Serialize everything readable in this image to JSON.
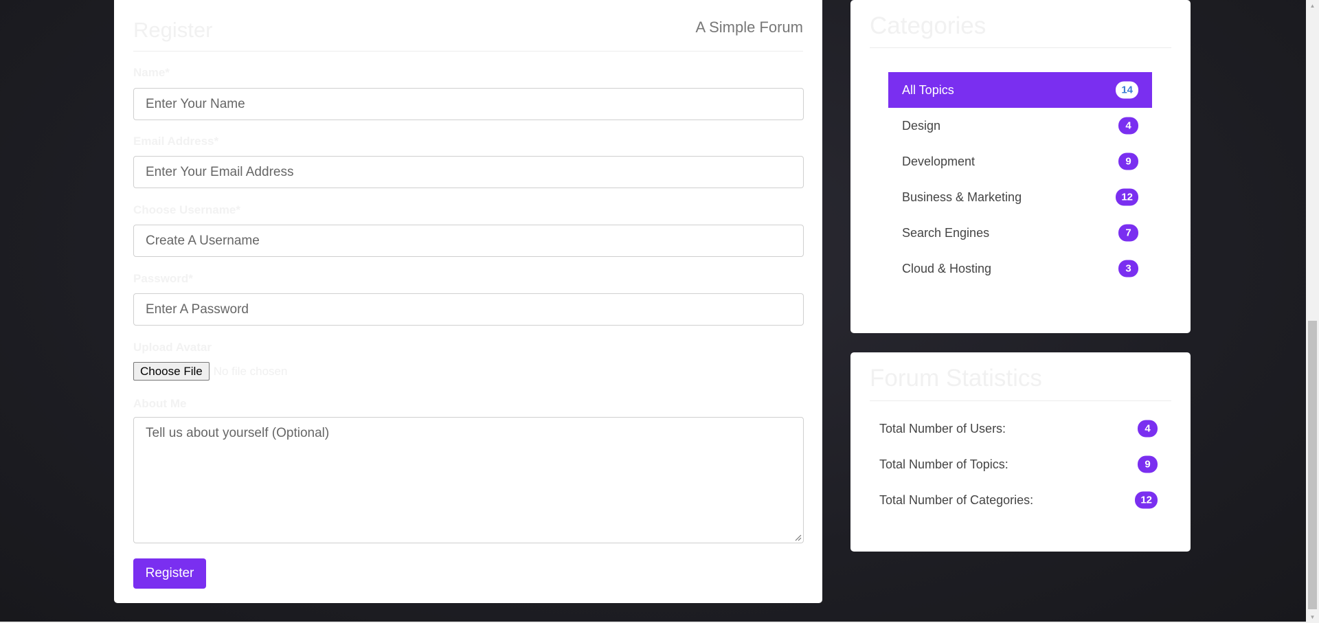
{
  "register": {
    "title": "Register",
    "forum_name": "A Simple Forum",
    "fields": {
      "name_label": "Name*",
      "name_placeholder": "Enter Your Name",
      "email_label": "Email Address*",
      "email_placeholder": "Enter Your Email Address",
      "username_label": "Choose Username*",
      "username_placeholder": "Create A Username",
      "password_label": "Password*",
      "password_placeholder": "Enter A Password",
      "avatar_label": "Upload Avatar",
      "file_button": "Choose File",
      "file_status": "No file chosen",
      "about_label": "About Me",
      "about_placeholder": "Tell us about yourself (Optional)"
    },
    "submit_label": "Register"
  },
  "categories": {
    "title": "Categories",
    "items": [
      {
        "label": "All Topics",
        "count": "14"
      },
      {
        "label": "Design",
        "count": "4"
      },
      {
        "label": "Development",
        "count": "9"
      },
      {
        "label": "Business & Marketing",
        "count": "12"
      },
      {
        "label": "Search Engines",
        "count": "7"
      },
      {
        "label": "Cloud & Hosting",
        "count": "3"
      }
    ]
  },
  "stats": {
    "title": "Forum Statistics",
    "items": [
      {
        "label": "Total Number of Users:",
        "count": "4"
      },
      {
        "label": "Total Number of Topics:",
        "count": "9"
      },
      {
        "label": "Total Number of Categories:",
        "count": "12"
      }
    ]
  },
  "colors": {
    "accent": "#7a2ff0",
    "active_badge_text": "#3a7bd5"
  }
}
